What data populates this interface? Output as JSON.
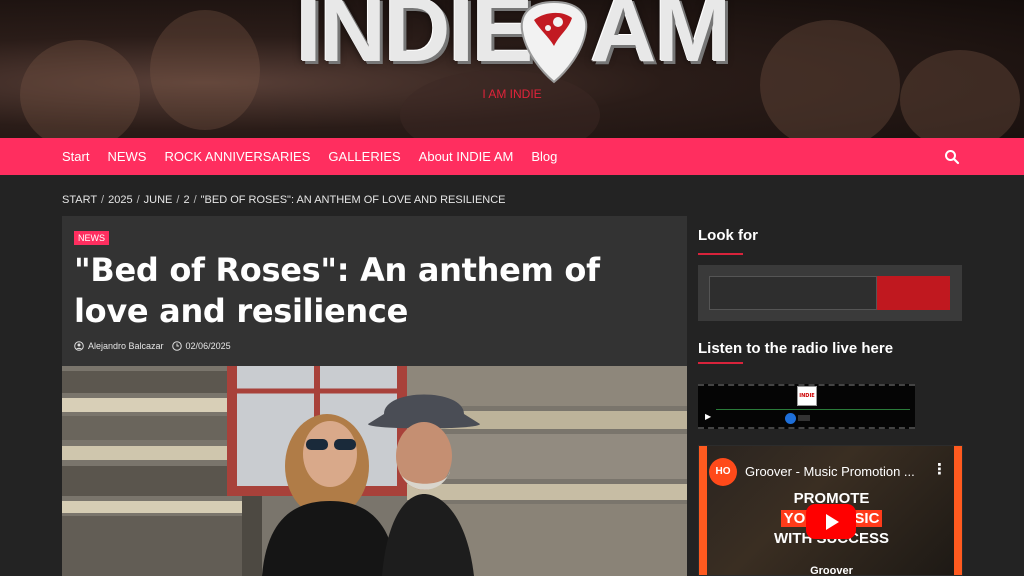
{
  "header": {
    "logo_left": "INDIE",
    "logo_right": "AM",
    "tagline": "I AM INDIE"
  },
  "nav": {
    "items": [
      "Start",
      "NEWS",
      "ROCK ANNIVERSARIES",
      "GALLERIES",
      "About INDIE AM",
      "Blog"
    ],
    "search_icon": "search-icon"
  },
  "breadcrumb": [
    "START",
    "2025",
    "JUNE",
    "2",
    "\"BED OF ROSES\": AN ANTHEM OF LOVE AND RESILIENCE"
  ],
  "article": {
    "category": "NEWS",
    "title": "\"Bed of Roses\": An anthem of love and resilience",
    "author": "Alejandro Balcazar",
    "date": "02/06/2025"
  },
  "sidebar": {
    "search_heading": "Look for",
    "search_placeholder": "",
    "radio_heading": "Listen to the radio live here",
    "radio_logo": "INDIE"
  },
  "video": {
    "channel_avatar": "HO",
    "title": "Groover - Music Promotion ...",
    "lines": [
      "PROMOTE",
      "YOUR MUSIC",
      "WITH SUCCESS"
    ],
    "brand": "Groover"
  },
  "colors": {
    "accent": "#ff2e5f",
    "background": "#232323",
    "card": "#333333",
    "underline": "#d8233b"
  }
}
